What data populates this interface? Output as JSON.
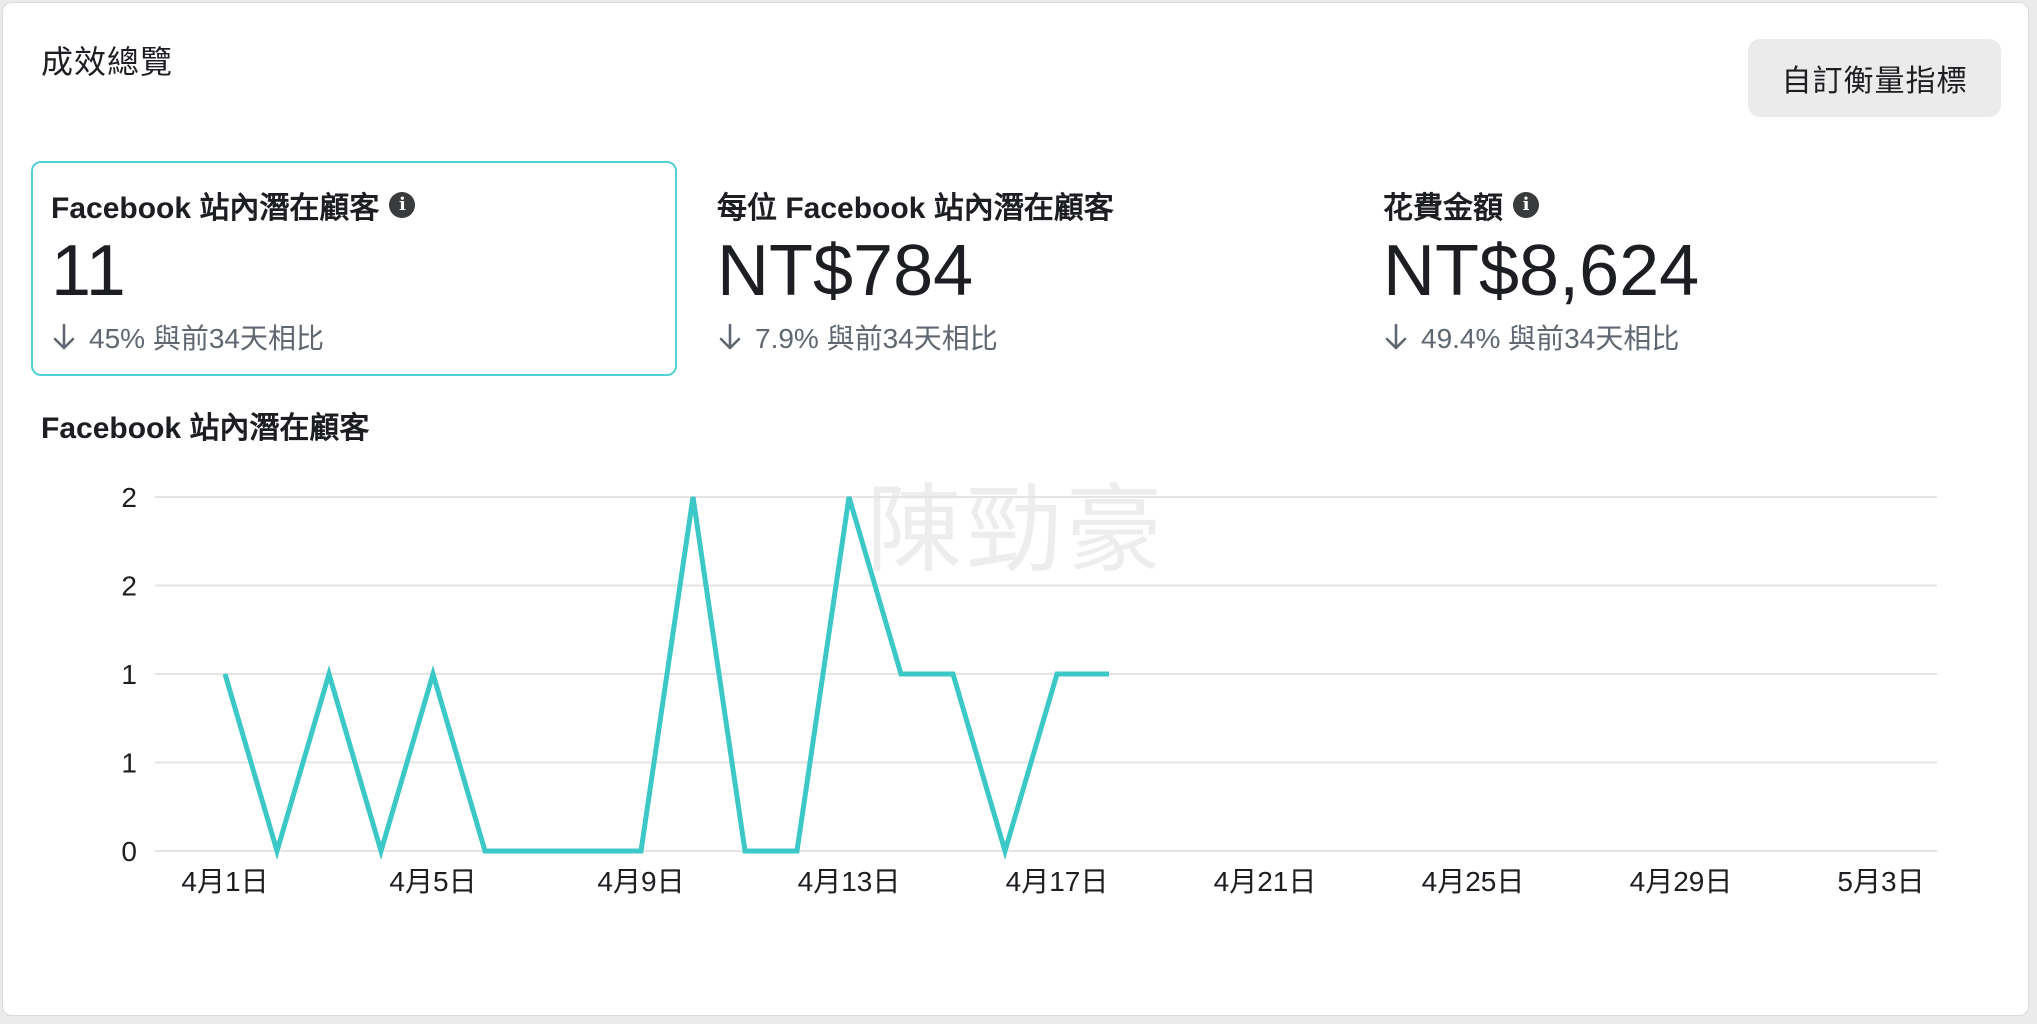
{
  "header": {
    "title": "成效總覽",
    "custom_metrics_button": "自訂衡量指標"
  },
  "metrics": [
    {
      "label": "Facebook 站內潛在顧客",
      "has_info": true,
      "value": "11",
      "change": "45% 與前34天相比",
      "selected": true
    },
    {
      "label": "每位 Facebook 站內潛在顧客",
      "has_info": false,
      "value": "NT$784",
      "change": "7.9% 與前34天相比",
      "selected": false
    },
    {
      "label": "花費金額",
      "has_info": true,
      "value": "NT$8,624",
      "change": "49.4% 與前34天相比",
      "selected": false
    }
  ],
  "watermark": "陳勁豪",
  "colors": {
    "accent": "#3cc8c6",
    "selected_border": "#52d1d5",
    "grid": "#e4e4e4",
    "text": "#1c1e21",
    "muted": "#606770"
  },
  "chart_data": {
    "type": "line",
    "title": "Facebook 站內潛在顧客",
    "xlabel": "",
    "ylabel": "",
    "x": [
      "4月1日",
      "4月2日",
      "4月3日",
      "4月4日",
      "4月5日",
      "4月6日",
      "4月7日",
      "4月8日",
      "4月9日",
      "4月10日",
      "4月11日",
      "4月12日",
      "4月13日",
      "4月14日",
      "4月15日",
      "4月16日",
      "4月17日",
      "4月18日"
    ],
    "values": [
      1,
      0,
      1,
      0,
      1,
      0,
      0,
      0,
      0,
      2,
      0,
      0,
      2,
      1,
      1,
      0,
      1,
      1
    ],
    "x_tick_labels": [
      "4月1日",
      "4月5日",
      "4月9日",
      "4月13日",
      "4月17日",
      "4月21日",
      "4月25日",
      "4月29日",
      "5月3日"
    ],
    "y_tick_labels": [
      "0",
      "1",
      "1",
      "2",
      "2"
    ],
    "ylim": [
      0,
      2
    ],
    "x_range_days": [
      0,
      32
    ],
    "grid": true,
    "legend": "none"
  }
}
